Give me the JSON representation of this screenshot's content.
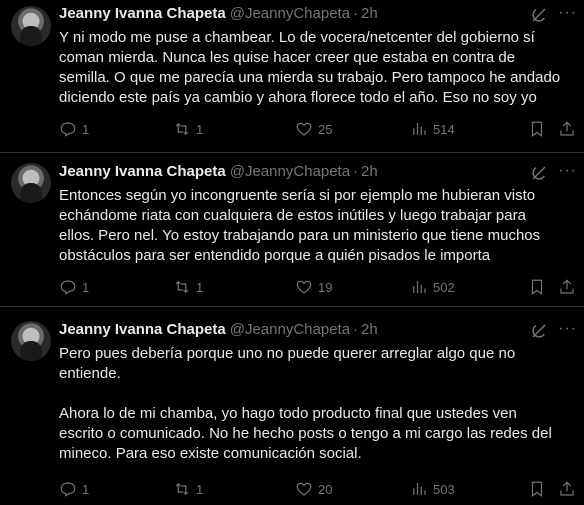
{
  "tweets": [
    {
      "name": "Jeanny Ivanna Chapeta",
      "handle": "@JeannyChapeta",
      "dot": "·",
      "time": "2h",
      "text": "Y ni modo me puse a chambear. Lo de vocera/netcenter del gobierno sí\ncoman mierda. Nunca les quise hacer creer que estaba en contra de\nsemilla. O que me parecía una mierda su trabajo. Pero tampoco he andado\ndiciendo este país ya cambio y ahora florece todo el año. Eso no soy yo",
      "replies": "1",
      "retweets": "1",
      "likes": "25",
      "views": "514"
    },
    {
      "name": "Jeanny Ivanna Chapeta",
      "handle": "@JeannyChapeta",
      "dot": "·",
      "time": "2h",
      "text": "Entonces según yo incongruente sería si por ejemplo me hubieran visto\nechándome riata con cualquiera de estos inútiles y luego trabajar para\nellos. Pero nel. Yo estoy trabajando para un ministerio que tiene muchos\nobstáculos para ser entendido porque a quién pisados le importa",
      "replies": "1",
      "retweets": "1",
      "likes": "19",
      "views": "502"
    },
    {
      "name": "Jeanny Ivanna Chapeta",
      "handle": "@JeannyChapeta",
      "dot": "·",
      "time": "2h",
      "text": "Pero pues debería porque uno no puede querer arreglar algo que no\nentiende.\n\nAhora lo de mi chamba, yo hago todo producto final que ustedes ven\nescrito o comunicado. No he hecho posts o tengo a mi cargo las redes del\nmineco. Para eso existe comunicación social.",
      "replies": "1",
      "retweets": "1",
      "likes": "20",
      "views": "503"
    }
  ],
  "icons": {
    "reply": "reply-icon",
    "retweet": "retweet-icon",
    "like": "heart-icon",
    "views": "views-icon",
    "bookmark": "bookmark-icon",
    "share": "share-icon",
    "grok": "grok-icon",
    "more": "more-icon"
  },
  "colors": {
    "background": "#000000",
    "text": "#e7e9ea",
    "muted": "#71767b",
    "divider": "#2f3336"
  }
}
